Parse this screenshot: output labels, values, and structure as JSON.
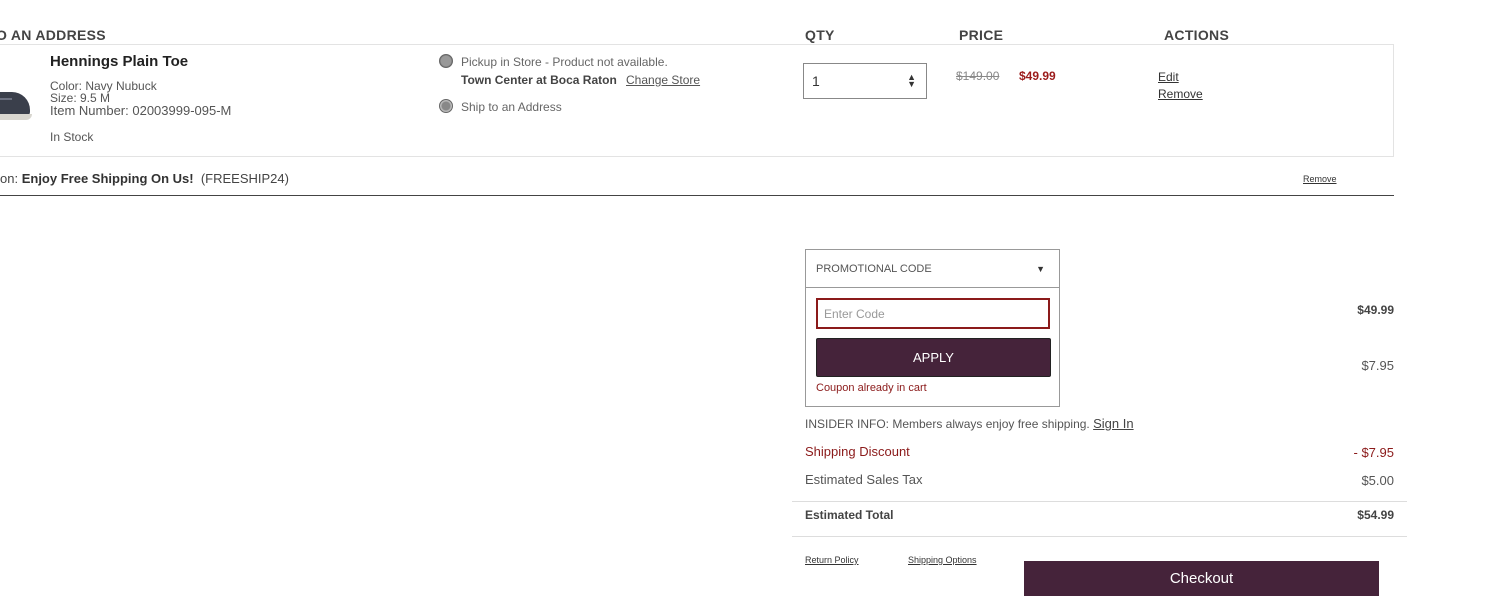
{
  "headers": {
    "ship": "O AN ADDRESS",
    "qty": "QTY",
    "price": "PRICE",
    "actions": "ACTIONS"
  },
  "product": {
    "name": "Hennings Plain Toe",
    "color": "Color: Navy Nubuck",
    "size": "Size: 9.5 M",
    "item_number": "Item Number: 02003999-095-M",
    "stock": "In Stock",
    "image_icon": "shoe-image",
    "fulfillment": {
      "pickup_text": "Pickup in Store - Product not available.",
      "store_name": "Town Center at Boca Raton",
      "change_store": "Change Store",
      "ship_text": "Ship to an Address"
    },
    "qty": "1",
    "price_original": "$149.00",
    "price_sale": "$49.99",
    "edit": "Edit",
    "remove": "Remove"
  },
  "promo_applied": {
    "prefix": "on:",
    "name": "Enjoy Free Shipping On Us!",
    "code": "(FREESHIP24)",
    "remove": "Remove"
  },
  "promo_panel": {
    "header": "PROMOTIONAL CODE",
    "caret_icon": "triangle-down",
    "input_placeholder": "Enter Code",
    "input_value": "",
    "apply": "APPLY",
    "message": "Coupon already in cart"
  },
  "summary": {
    "subtotal": "$49.99",
    "shipping": "$7.95",
    "insider_text": "INSIDER INFO: Members always enjoy free shipping.",
    "sign_in": "Sign In",
    "shipping_discount_label": "Shipping Discount",
    "shipping_discount_value": "- $7.95",
    "tax_label": "Estimated Sales Tax",
    "tax_value": "$5.00",
    "total_label": "Estimated Total",
    "total_value": "$54.99"
  },
  "footer": {
    "return_policy": "Return Policy",
    "shipping_options": "Shipping Options",
    "checkout": "Checkout"
  },
  "colors": {
    "brand": "#45233a",
    "sale_red": "#9b1b1b",
    "error_red": "#8b1a1a"
  }
}
